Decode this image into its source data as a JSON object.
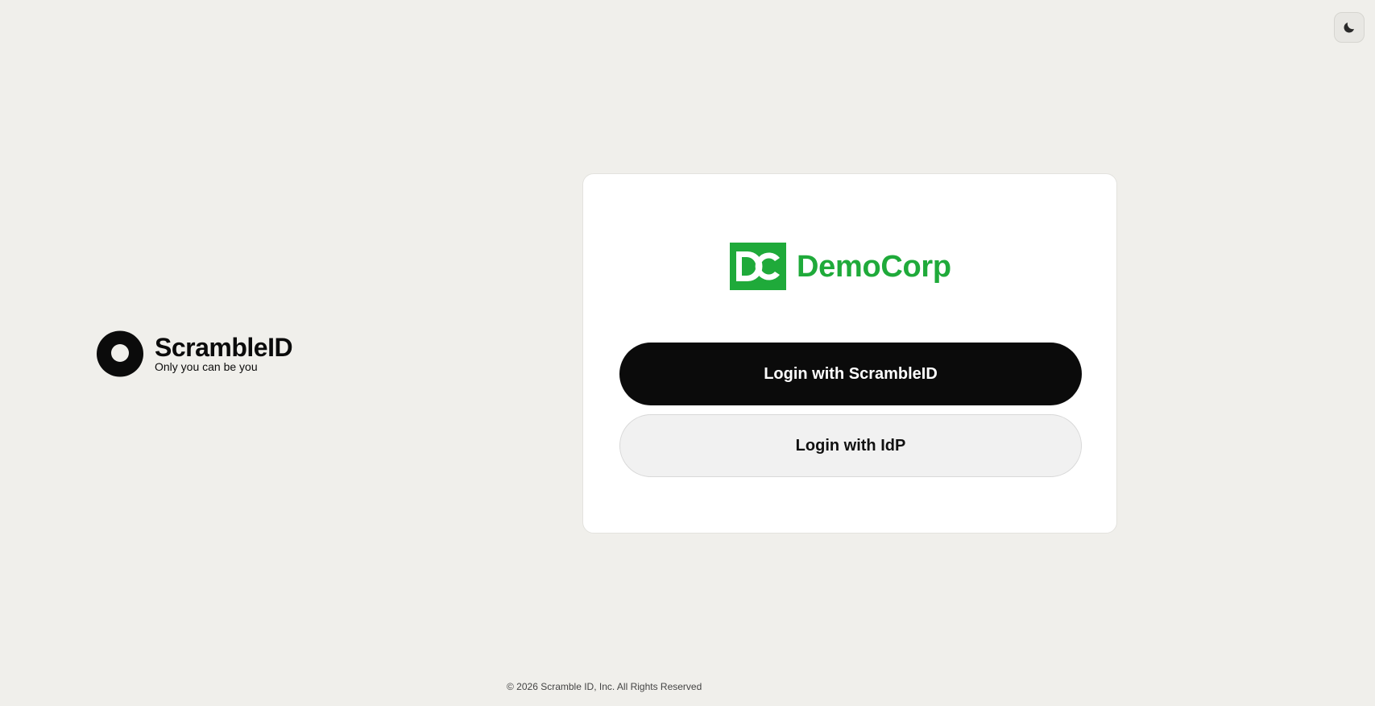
{
  "theme_toggle": {
    "icon": "moon-icon",
    "label": "Toggle theme"
  },
  "brand": {
    "name": "ScrambleID",
    "tagline": "Only you can be you",
    "icon": "scrambleid-logo-icon"
  },
  "card": {
    "company_name": "DemoCorp",
    "company_color": "#1faa3a",
    "login_scrambleid_label": "Login with ScrambleID",
    "login_idp_label": "Login with IdP"
  },
  "footer": {
    "copyright": "© 2026 Scramble ID, Inc. All Rights Reserved"
  },
  "colors": {
    "background": "#f0efeb",
    "primary_button": "#0b0b0b",
    "secondary_button": "#f1f1f1",
    "brand_green": "#1faa3a"
  }
}
